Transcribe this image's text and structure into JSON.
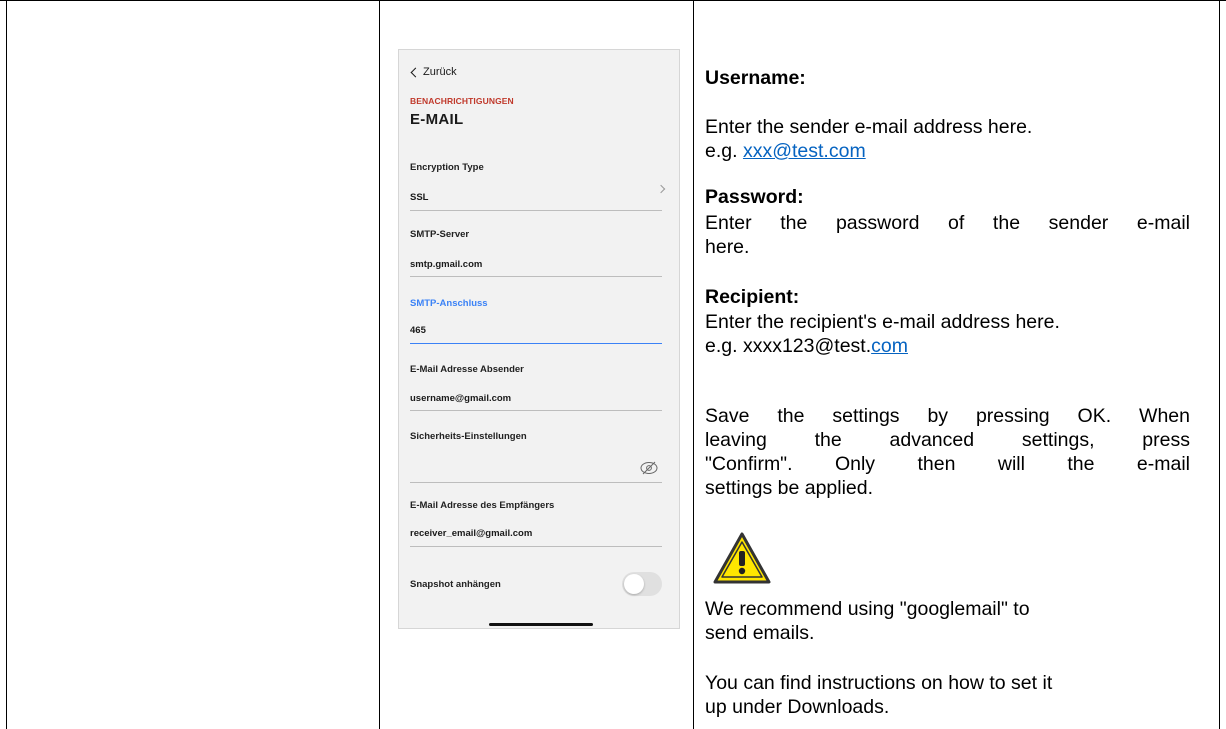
{
  "phone": {
    "back_label": "Zurück",
    "section_label": "BENACHRICHTIGUNGEN",
    "page_title": "E-MAIL",
    "fields": [
      {
        "label": "Encryption Type",
        "value": "SSL"
      },
      {
        "label": "SMTP-Server",
        "value": "smtp.gmail.com"
      },
      {
        "label": "SMTP-Anschluss",
        "value": "465"
      },
      {
        "label": "E-Mail Adresse Absender",
        "value": "username@gmail.com"
      },
      {
        "label": "Sicherheits-Einstellungen",
        "value": ""
      },
      {
        "label": "E-Mail Adresse des Empfängers",
        "value": "receiver_email@gmail.com"
      }
    ],
    "snapshot_label": "Snapshot anhängen",
    "snapshot_enabled": false
  },
  "doc": {
    "username_heading": "Username:",
    "username_text": "Enter the sender e-mail address here.",
    "username_example_prefix": "e.g. ",
    "username_example_link": "xxx@test.com",
    "password_heading": "Password:",
    "password_text_1": "Enter the password of the sender e-mail",
    "password_text_2": "here.",
    "recipient_heading": "Recipient:",
    "recipient_text": "Enter the recipient's e-mail address here.",
    "recipient_example_prefix": "e.g. xxxx123@test.",
    "recipient_example_link": "com",
    "save_line_1": "Save the settings by pressing OK. When",
    "save_line_2": "leaving the advanced settings, press",
    "save_line_3": "\"Confirm\". Only then will the e-mail",
    "save_line_4": "settings be applied.",
    "recommend_line_1": "We recommend using \"googlemail\" to",
    "recommend_line_2": "send emails.",
    "instructions_line_1": "You can find instructions on how to set it",
    "instructions_line_2": "up under Downloads."
  },
  "colors": {
    "section_red": "#c0392b",
    "active_blue": "#3b82f6",
    "link_blue": "#0563c1",
    "warning_yellow": "#ffe600"
  }
}
